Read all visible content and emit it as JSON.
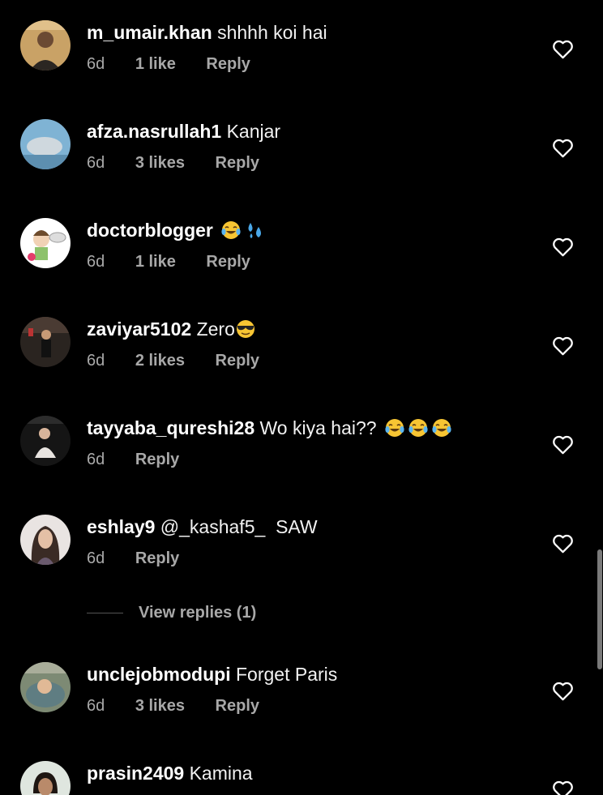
{
  "comments": [
    {
      "username": "m_umair.khan",
      "text": "shhhh koi hai",
      "time": "6d",
      "likes": "1 like",
      "reply": "Reply",
      "emojis": []
    },
    {
      "username": "afza.nasrullah1",
      "text": "Kanjar",
      "time": "6d",
      "likes": "3 likes",
      "reply": "Reply",
      "emojis": []
    },
    {
      "username": "doctorblogger",
      "text": "",
      "time": "6d",
      "likes": "1 like",
      "reply": "Reply",
      "emojis": [
        "tears-of-joy-emoji",
        "sweat-droplets-emoji"
      ]
    },
    {
      "username": "zaviyar5102",
      "text": "Zero",
      "time": "6d",
      "likes": "2 likes",
      "reply": "Reply",
      "emojis": [
        "sunglasses-emoji"
      ]
    },
    {
      "username": "tayyaba_qureshi28",
      "text": "Wo kiya hai??",
      "time": "6d",
      "likes": "",
      "reply": "Reply",
      "emojis": [
        "tears-of-joy-emoji",
        "tears-of-joy-emoji",
        "tears-of-joy-emoji"
      ]
    },
    {
      "username": "eshlay9",
      "text": "@_kashaf5_  SAW",
      "time": "6d",
      "likes": "",
      "reply": "Reply",
      "emojis": []
    },
    {
      "username": "unclejobmodupi",
      "text": "Forget Paris",
      "time": "6d",
      "likes": "3 likes",
      "reply": "Reply",
      "emojis": []
    },
    {
      "username": "prasin2409",
      "text": "Kamina",
      "time": "",
      "likes": "",
      "reply": "",
      "emojis": []
    }
  ],
  "view_replies": {
    "label": "View replies (1)"
  },
  "icons": {
    "like": "heart-outline-icon"
  },
  "colors": {
    "background": "#000000",
    "text": "#ffffff",
    "secondary": "#a8a8a8"
  }
}
